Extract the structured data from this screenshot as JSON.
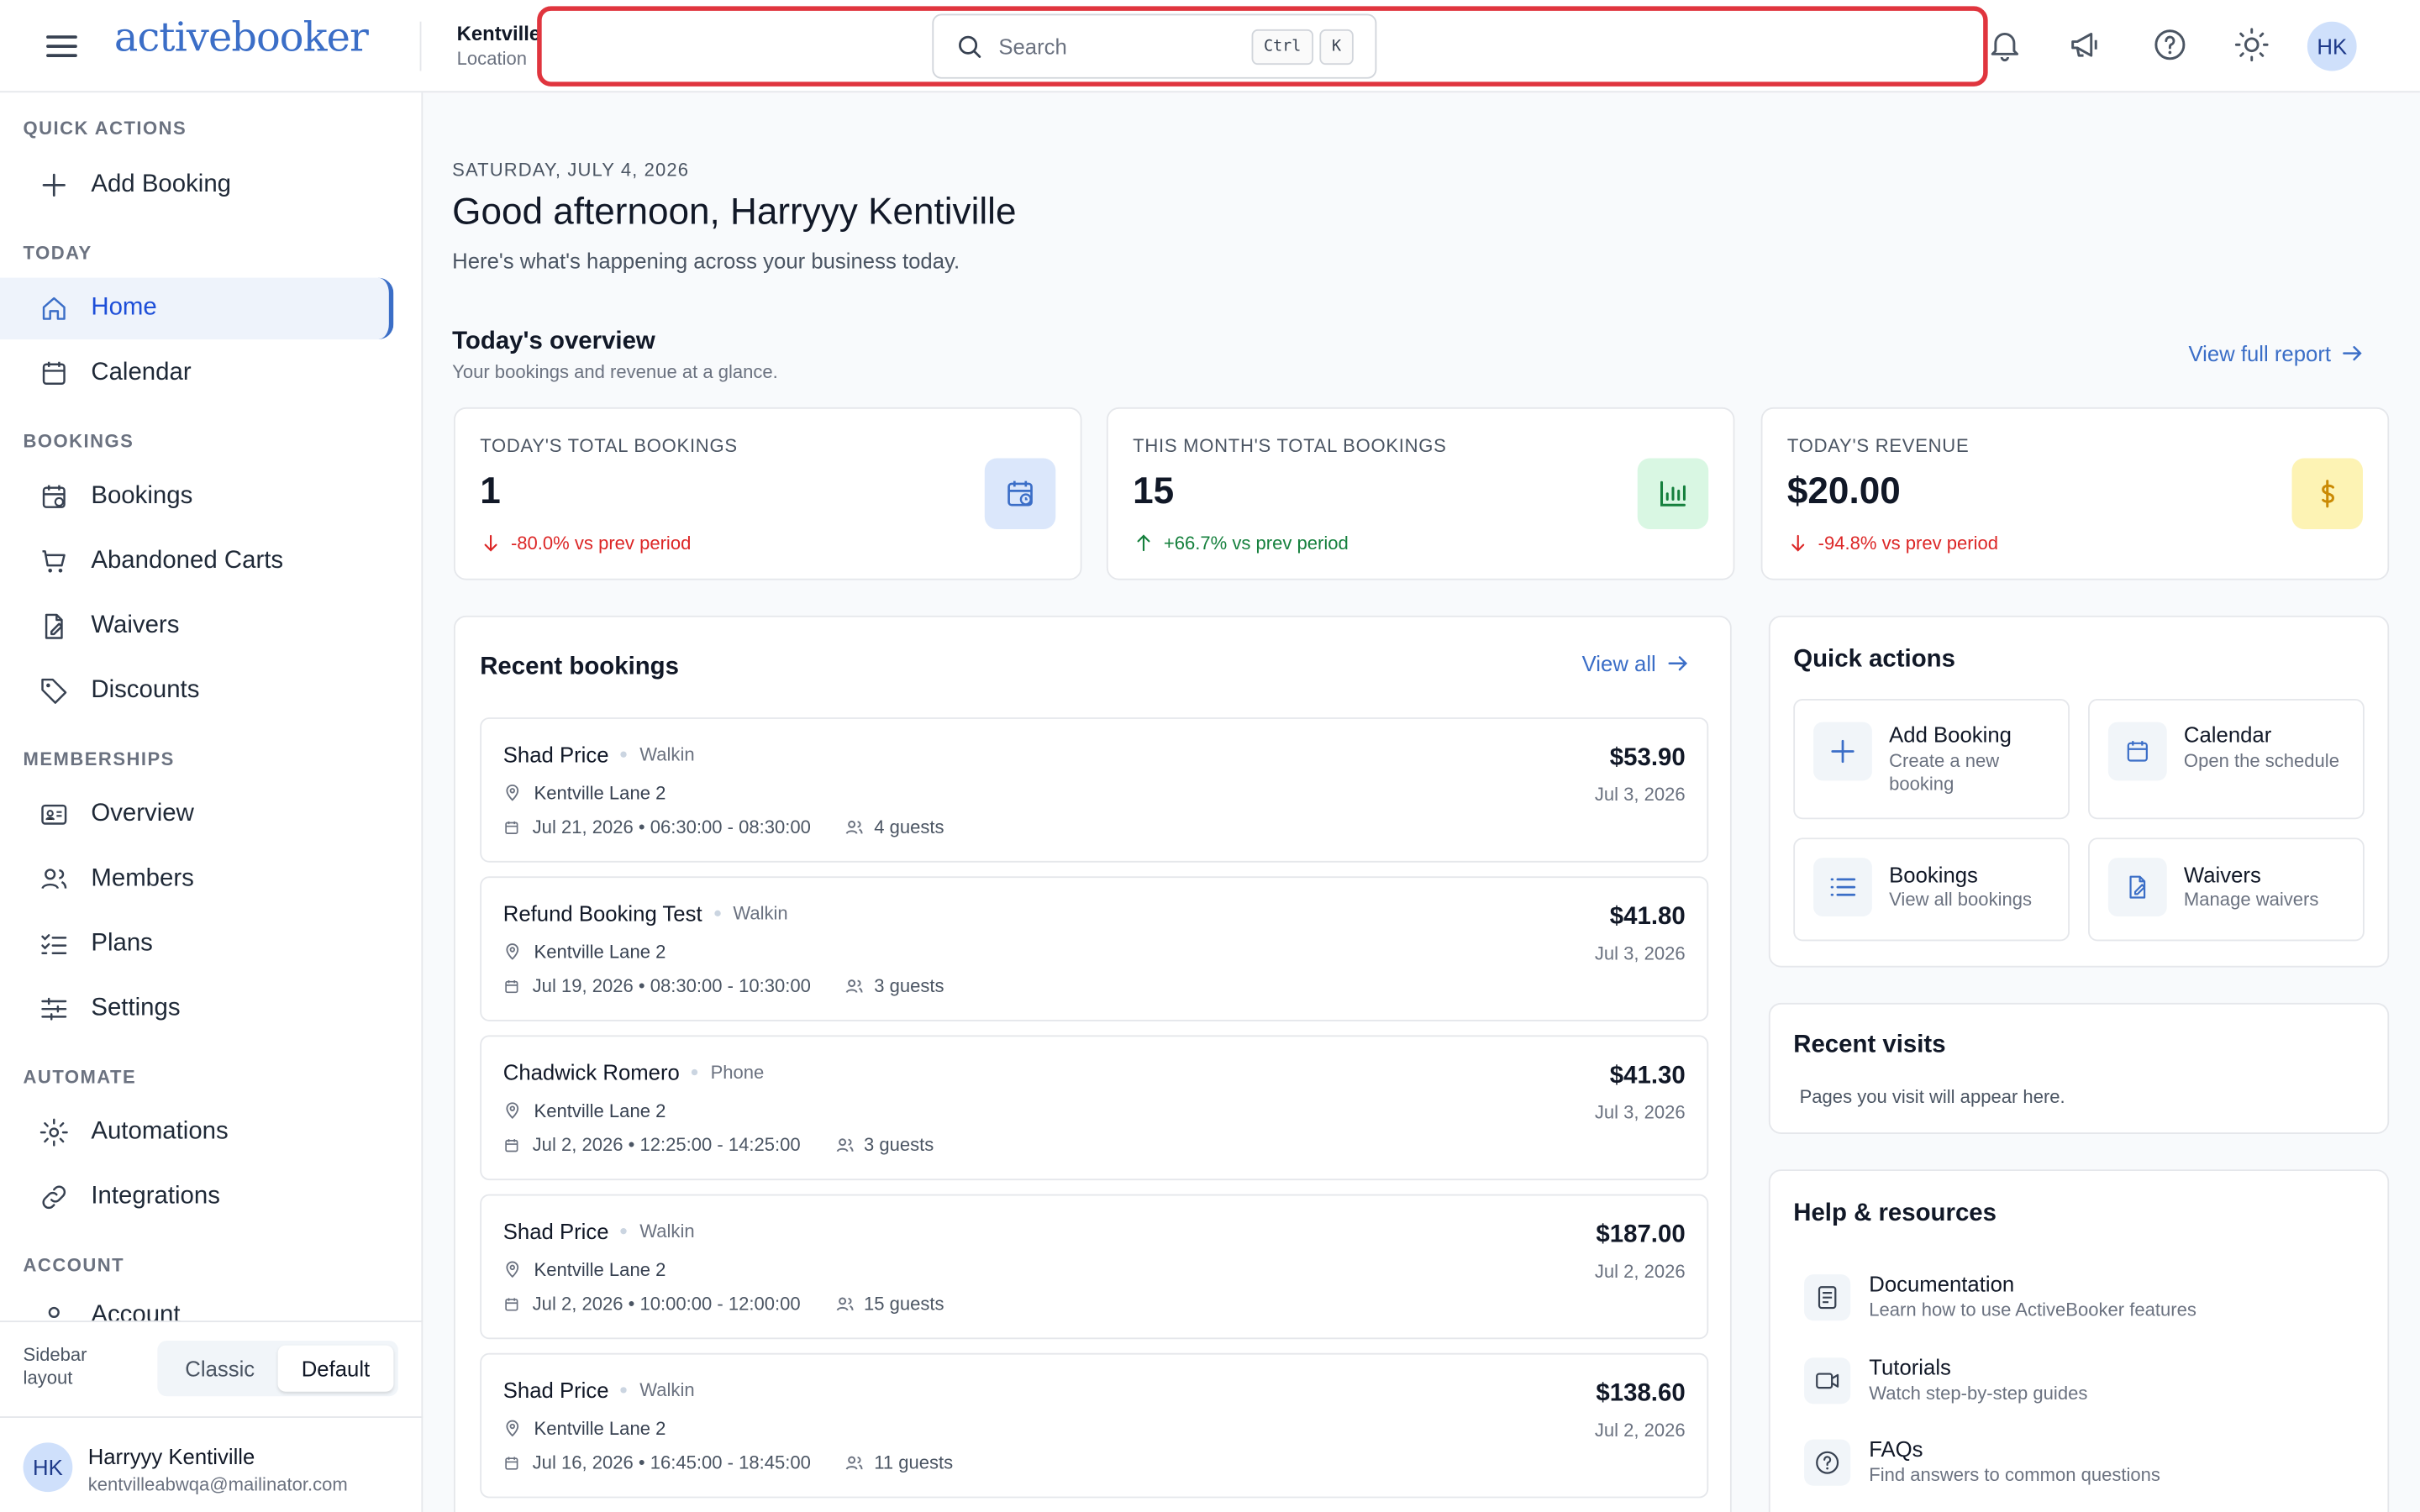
{
  "header": {
    "logo": "activebooker",
    "location_name": "Kentville",
    "location_label": "Location",
    "search_placeholder": "Search",
    "kbd_ctrl": "Ctrl",
    "kbd_k": "K",
    "avatar": "HK"
  },
  "sidebar": {
    "sections": {
      "quick_actions": "QUICK ACTIONS",
      "today": "TODAY",
      "bookings": "BOOKINGS",
      "memberships": "MEMBERSHIPS",
      "automate": "AUTOMATE",
      "account": "ACCOUNT"
    },
    "items": {
      "add_booking": "Add Booking",
      "home": "Home",
      "calendar": "Calendar",
      "bookings": "Bookings",
      "abandoned_carts": "Abandoned Carts",
      "waivers": "Waivers",
      "discounts": "Discounts",
      "overview": "Overview",
      "members": "Members",
      "plans": "Plans",
      "settings": "Settings",
      "automations": "Automations",
      "integrations": "Integrations",
      "account": "Account"
    },
    "layout_label_1": "Sidebar",
    "layout_label_2": "layout",
    "layout_classic": "Classic",
    "layout_default": "Default",
    "user": {
      "initials": "HK",
      "name": "Harryyy Kentiville",
      "email": "kentvilleabwqa@mailinator.com"
    }
  },
  "main": {
    "date": "SATURDAY, JULY 4, 2026",
    "greeting": "Good afternoon, Harryyy Kentiville",
    "subtitle": "Here's what's happening across your business today.",
    "overview_title": "Today's overview",
    "overview_sub": "Your bookings and revenue at a glance.",
    "view_full_report": "View full report",
    "stats": [
      {
        "label": "TODAY'S TOTAL BOOKINGS",
        "value": "1",
        "change": "-80.0% vs prev period",
        "color": "#dc2626"
      },
      {
        "label": "THIS MONTH'S TOTAL BOOKINGS",
        "value": "15",
        "change": "+66.7% vs prev period",
        "color": "#15803d"
      },
      {
        "label": "TODAY'S REVENUE",
        "value": "$20.00",
        "change": "-94.8% vs prev period",
        "color": "#dc2626"
      }
    ],
    "recent_bookings_title": "Recent bookings",
    "view_all": "View all",
    "bookings": [
      {
        "name": "Shad Price",
        "channel": "Walkin",
        "lane": "Kentville Lane 2",
        "date": "Jul 21, 2026 • 06:30:00 - 08:30:00",
        "guests": "4 guests",
        "amount": "$53.90",
        "created": "Jul 3, 2026"
      },
      {
        "name": "Refund Booking Test",
        "channel": "Walkin",
        "lane": "Kentville Lane 2",
        "date": "Jul 19, 2026 • 08:30:00 - 10:30:00",
        "guests": "3 guests",
        "amount": "$41.80",
        "created": "Jul 3, 2026"
      },
      {
        "name": "Chadwick Romero",
        "channel": "Phone",
        "lane": "Kentville Lane 2",
        "date": "Jul 2, 2026 • 12:25:00 - 14:25:00",
        "guests": "3 guests",
        "amount": "$41.30",
        "created": "Jul 3, 2026"
      },
      {
        "name": "Shad Price",
        "channel": "Walkin",
        "lane": "Kentville Lane 2",
        "date": "Jul 2, 2026 • 10:00:00 - 12:00:00",
        "guests": "15 guests",
        "amount": "$187.00",
        "created": "Jul 2, 2026"
      },
      {
        "name": "Shad Price",
        "channel": "Walkin",
        "lane": "Kentville Lane 2",
        "date": "Jul 16, 2026 • 16:45:00 - 18:45:00",
        "guests": "11 guests",
        "amount": "$138.60",
        "created": "Jul 2, 2026"
      }
    ],
    "quick_actions_title": "Quick actions",
    "quick_actions": [
      {
        "title": "Add Booking",
        "sub": "Create a new booking"
      },
      {
        "title": "Calendar",
        "sub": "Open the schedule"
      },
      {
        "title": "Bookings",
        "sub": "View all bookings"
      },
      {
        "title": "Waivers",
        "sub": "Manage waivers"
      }
    ],
    "recent_visits_title": "Recent visits",
    "recent_visits_empty": "Pages you visit will appear here.",
    "help_title": "Help & resources",
    "help": [
      {
        "title": "Documentation",
        "sub": "Learn how to use ActiveBooker features"
      },
      {
        "title": "Tutorials",
        "sub": "Watch step-by-step guides"
      },
      {
        "title": "FAQs",
        "sub": "Find answers to common questions"
      }
    ]
  },
  "colors": {
    "accent": "#3b6ec7",
    "highlight": "#e0353e",
    "negative": "#dc2626",
    "positive": "#15803d"
  }
}
